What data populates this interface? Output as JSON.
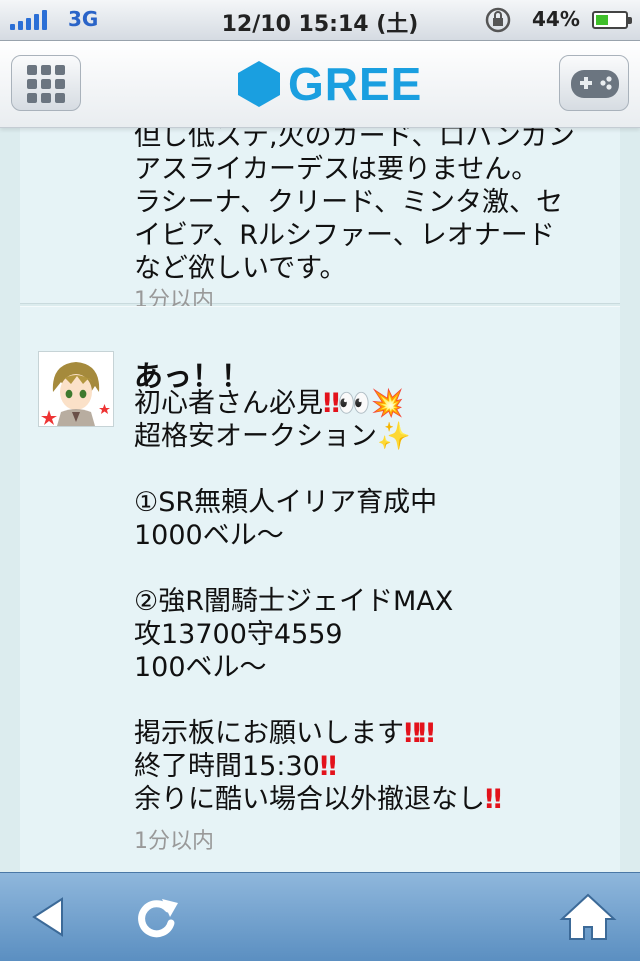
{
  "status_bar": {
    "network": "3G",
    "datetime": "12/10 15:14 (土)",
    "battery_percent": "44%",
    "battery_level": 0.44,
    "accent_color": "#2b6fd6"
  },
  "header": {
    "logo_text": "GREE",
    "menu_icon": "grid-icon",
    "game_icon": "gamepad-icon",
    "brand_color": "#1a9fe0"
  },
  "feed": {
    "posts": [
      {
        "lines": [
          "但し低ステ,火のカード、ロバンガン",
          "アスライカーデスは要りません。",
          "ラシーナ、クリード、ミンタ激、セ",
          "イビア、Rルシファー、レオナード",
          "など欲しいです。"
        ],
        "time": "1分以内"
      },
      {
        "author": "あっ！！",
        "lines": [
          "初心者さん必見",
          "超格安オークション",
          "",
          "①SR無頼人イリア育成中",
          "1000ベル〜",
          "",
          "②強R闇騎士ジェイドMAX",
          "攻13700守4559",
          "100ベル〜",
          "",
          "掲示板にお願いします",
          "終了時間15:30",
          "余りに酷い場合以外撤退なし"
        ],
        "emoji": {
          "double_bang": "‼",
          "double_bang_pair": "‼‼",
          "eyes": "👀",
          "sparkle_burst": "💥",
          "sparkles": "✨"
        },
        "time": "1分以内"
      }
    ]
  },
  "toolbar": {
    "back_icon": "back-arrow-icon",
    "reload_icon": "reload-icon",
    "home_icon": "home-icon"
  }
}
